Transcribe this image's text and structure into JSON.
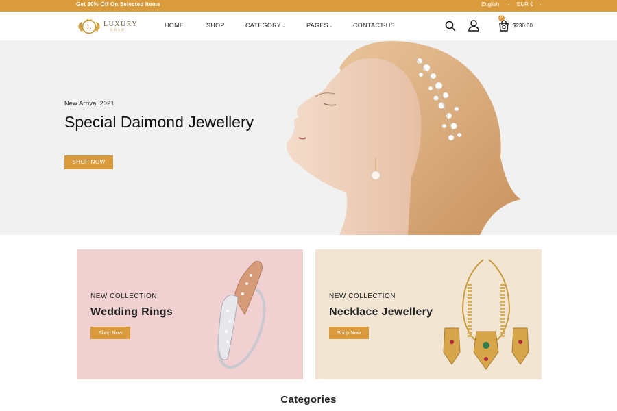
{
  "topbar": {
    "promo": "Get 30% Off On Selected Items",
    "language": "English",
    "currency": "EUR €"
  },
  "header": {
    "logo": {
      "brand": "LUXURY",
      "sub": "GOLD",
      "letter": "L"
    },
    "nav": [
      {
        "label": "HOME",
        "has_caret": false
      },
      {
        "label": "SHOP",
        "has_caret": false
      },
      {
        "label": "CATEGORY",
        "has_caret": true
      },
      {
        "label": "PAGES",
        "has_caret": true
      },
      {
        "label": "CONTACT-US",
        "has_caret": true
      }
    ],
    "cart": {
      "count": "0",
      "total": "$230.00"
    },
    "icons": [
      "search-icon",
      "user-icon",
      "cart-icon"
    ]
  },
  "hero": {
    "kicker": "New Arrival 2021",
    "title": "Special Daimond Jewellery",
    "button": "SHOP NOW"
  },
  "banners": [
    {
      "eyebrow": "NEW COLLECTION",
      "heading": "Wedding Rings",
      "button": "Shop Now"
    },
    {
      "eyebrow": "NEW COLLECTION",
      "heading": "Necklace Jewellery",
      "button": "Shop Now"
    }
  ],
  "section_title": "Categories",
  "colors": {
    "accent": "#d99b3c",
    "hero_bg": "#f1f1f1",
    "rings_bg": "#f0d0d1",
    "necklace_bg": "#f2e5d4"
  }
}
